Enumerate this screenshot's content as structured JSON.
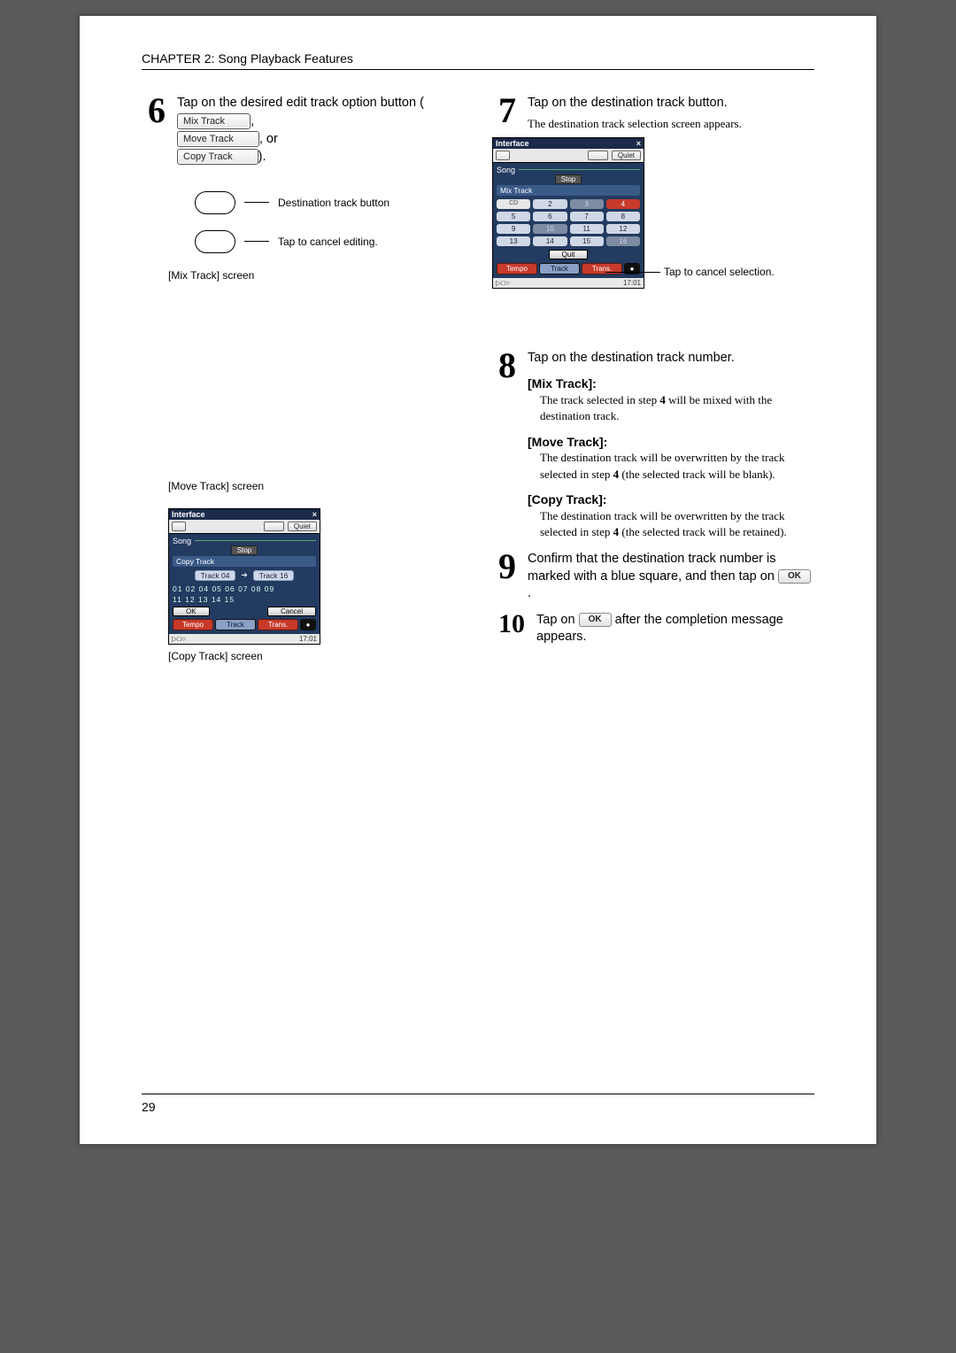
{
  "header": {
    "chapter": "CHAPTER 2: Song Playback Features"
  },
  "footer": {
    "page": "29"
  },
  "left": {
    "step6": {
      "num": "6",
      "title_a": "Tap on the desired edit track option button (",
      "opt_mix": "Mix Track",
      "sep1": ",",
      "opt_move": "Move Track",
      "sep2": ", or",
      "opt_copy": "Copy Track",
      "close": ")."
    },
    "diagram": {
      "label1": "Destination track button",
      "label2": "Tap to cancel editing."
    },
    "caption_mix": "[Mix Track] screen",
    "caption_move": "[Move Track] screen",
    "caption_copy": "[Copy Track] screen",
    "ss_move": {
      "title": "Interface",
      "top_left": "",
      "top_right": "Quiet",
      "song": "Song",
      "stop": "Stop",
      "mode": "Copy Track",
      "track_from": "Track 04",
      "track_to": "Track 16",
      "row1": "01 02     04 05 06 07 08 09",
      "row2": "11 12 13 14 15",
      "ok": "OK",
      "cancel": "Cancel",
      "tabs": [
        "Tempo",
        "Track",
        "Trans."
      ],
      "foot_left": "▷□○",
      "foot_right": "17:01"
    }
  },
  "right": {
    "step7": {
      "num": "7",
      "title": "Tap on the destination track button.",
      "sub": "The destination track selection screen appears.",
      "callout": "Tap to cancel selection."
    },
    "ss7": {
      "title": "Interface",
      "quiet": "Quiet",
      "song": "Song",
      "stop": "Stop",
      "mode": "Mix Track",
      "cd": "CD",
      "cells": [
        "2",
        "3",
        "4",
        "5",
        "6",
        "7",
        "8",
        "9",
        "10",
        "11",
        "12",
        "13",
        "14",
        "15",
        "16"
      ],
      "quit": "Quit",
      "tabs": [
        "Tempo",
        "Track",
        "Trans."
      ],
      "foot_right": "17:01"
    },
    "step8": {
      "num": "8",
      "title": "Tap on the destination track number.",
      "mix_h": "[Mix Track]:",
      "mix_b_a": "The track selected in step ",
      "mix_b_bold": "4",
      "mix_b_c": " will be mixed with the destination track.",
      "move_h": "[Move Track]:",
      "move_b_a": "The destination track will be overwritten by the track selected in step ",
      "move_b_bold": "4",
      "move_b_c": " (the selected track will be blank).",
      "copy_h": "[Copy Track]:",
      "copy_b_a": "The destination track will be overwritten by the track selected in step ",
      "copy_b_bold": "4",
      "copy_b_c": " (the selected track will be retained)."
    },
    "step9": {
      "num": "9",
      "title_a": "Confirm that the destination track number is marked with a blue square, and then tap on ",
      "ok": "OK",
      "title_b": "."
    },
    "step10": {
      "num": "10",
      "title_a": "Tap on ",
      "ok": "OK",
      "title_b": " after the completion message appears."
    }
  }
}
